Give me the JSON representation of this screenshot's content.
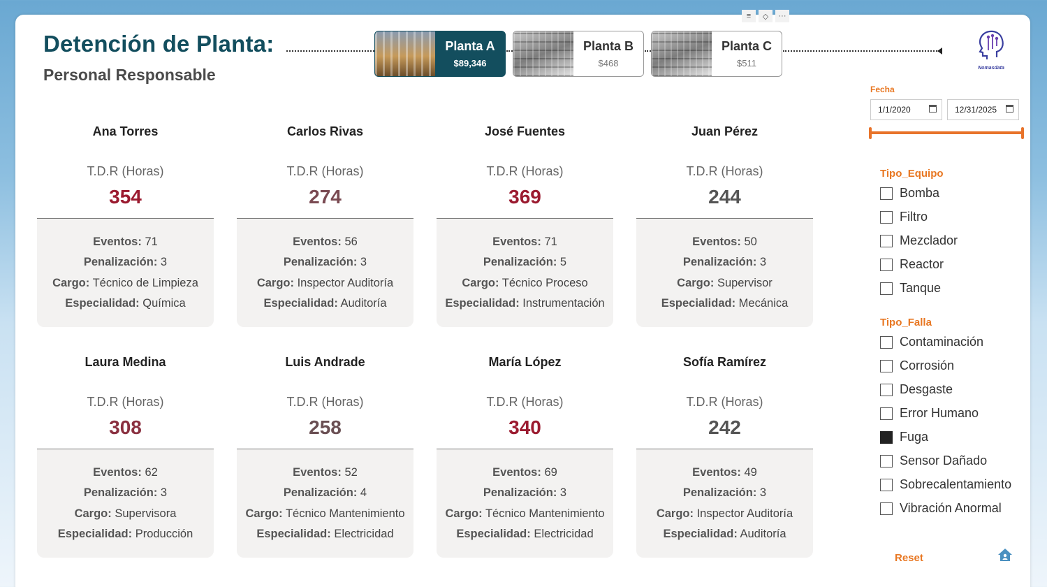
{
  "header": {
    "title": "Detención de Planta:",
    "subtitle": "Personal Responsable"
  },
  "plants": [
    {
      "name": "Planta A",
      "value": "$89,346",
      "active": true
    },
    {
      "name": "Planta B",
      "value": "$468",
      "active": false
    },
    {
      "name": "Planta C",
      "value": "$511",
      "active": false
    }
  ],
  "visual_toolbar": [
    "filter-icon",
    "eraser-icon",
    "more-options-icon"
  ],
  "logo": {
    "text": "Nomasdata"
  },
  "tdr_label": "T.D.R (Horas)",
  "field_labels": {
    "events": "Eventos:",
    "penalty": "Penalización:",
    "role": "Cargo:",
    "specialty": "Especialidad:"
  },
  "employees": [
    {
      "name": "Ana Torres",
      "tdr": "354",
      "tdr_color": "#9b1b30",
      "events": "71",
      "penalty": "3",
      "role": "Técnico de Limpieza",
      "specialty": "Química"
    },
    {
      "name": "Carlos Rivas",
      "tdr": "274",
      "tdr_color": "#7a4a52",
      "events": "56",
      "penalty": "3",
      "role": "Inspector Auditoría",
      "specialty": "Auditoría"
    },
    {
      "name": "José Fuentes",
      "tdr": "369",
      "tdr_color": "#9b1b30",
      "events": "71",
      "penalty": "5",
      "role": "Técnico Proceso",
      "specialty": "Instrumentación"
    },
    {
      "name": "Juan Pérez",
      "tdr": "244",
      "tdr_color": "#555555",
      "events": "50",
      "penalty": "3",
      "role": "Supervisor",
      "specialty": "Mecánica"
    },
    {
      "name": "Laura Medina",
      "tdr": "308",
      "tdr_color": "#8a3040",
      "events": "62",
      "penalty": "3",
      "role": "Supervisora",
      "specialty": "Producción"
    },
    {
      "name": "Luis Andrade",
      "tdr": "258",
      "tdr_color": "#6a4f53",
      "events": "52",
      "penalty": "4",
      "role": "Técnico Mantenimiento",
      "specialty": "Electricidad"
    },
    {
      "name": "María López",
      "tdr": "340",
      "tdr_color": "#9b1b30",
      "events": "69",
      "penalty": "3",
      "role": "Técnico Mantenimiento",
      "specialty": "Electricidad"
    },
    {
      "name": "Sofía Ramírez",
      "tdr": "242",
      "tdr_color": "#555555",
      "events": "49",
      "penalty": "3",
      "role": "Inspector Auditoría",
      "specialty": "Auditoría"
    }
  ],
  "filters": {
    "date": {
      "label": "Fecha",
      "start": "1/1/2020",
      "end": "12/31/2025"
    },
    "equipment": {
      "title": "Tipo_Equipo",
      "options": [
        {
          "label": "Bomba",
          "checked": false
        },
        {
          "label": "Filtro",
          "checked": false
        },
        {
          "label": "Mezclador",
          "checked": false
        },
        {
          "label": "Reactor",
          "checked": false
        },
        {
          "label": "Tanque",
          "checked": false
        }
      ]
    },
    "failure": {
      "title": "Tipo_Falla",
      "options": [
        {
          "label": "Contaminación",
          "checked": false
        },
        {
          "label": "Corrosión",
          "checked": false
        },
        {
          "label": "Desgaste",
          "checked": false
        },
        {
          "label": "Error Humano",
          "checked": false
        },
        {
          "label": "Fuga",
          "checked": true
        },
        {
          "label": "Sensor Dañado",
          "checked": false
        },
        {
          "label": "Sobrecalentamiento",
          "checked": false
        },
        {
          "label": "Vibración Anormal",
          "checked": false
        }
      ]
    },
    "reset_label": "Reset"
  },
  "colors": {
    "title": "#134e5e",
    "accent": "#e87722",
    "active_plant": "#134e5e"
  }
}
